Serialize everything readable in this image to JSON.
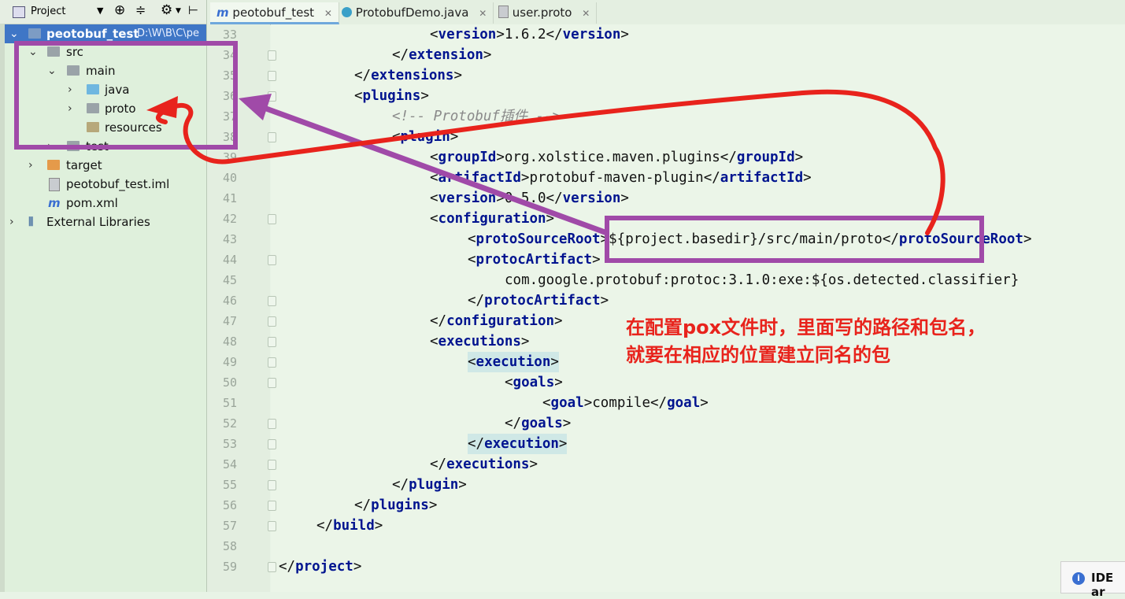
{
  "project_toolbar": {
    "title": "Project"
  },
  "tree": {
    "root_name": "peotobuf_test",
    "root_path": "D:\\W\\B\\C\\pe",
    "src": "src",
    "main": "main",
    "java": "java",
    "proto": "proto",
    "resources": "resources",
    "test": "test",
    "target": "target",
    "iml": "peotobuf_test.iml",
    "pom": "pom.xml",
    "ext": "External Libraries"
  },
  "tabs": [
    {
      "label": "peotobuf_test"
    },
    {
      "label": "ProtobufDemo.java"
    },
    {
      "label": "user.proto"
    }
  ],
  "gutter": {
    "line_numbers": [
      "33",
      "34",
      "35",
      "36",
      "37",
      "38",
      "39",
      "40",
      "41",
      "42",
      "43",
      "44",
      "45",
      "46",
      "47",
      "48",
      "49",
      "50",
      "51",
      "52",
      "53",
      "54",
      "55",
      "56",
      "57",
      "58",
      "59"
    ]
  },
  "code": {
    "l33_tag": "version",
    "l33_val": "1.6.2",
    "l34_tag": "extension",
    "l35_tag": "extensions",
    "l36_tag": "plugins",
    "l37_comment": "<!-- Protobuf插件 -->",
    "l38_tag": "plugin",
    "l39_tag": "groupId",
    "l39_val": "org.xolstice.maven.plugins",
    "l40_tag": "artifactId",
    "l40_val": "protobuf-maven-plugin",
    "l41_tag": "version",
    "l41_val": "0.5.0",
    "l42_tag": "configuration",
    "l43_tag": "protoSourceRoot",
    "l43_val": "${project.basedir}/src/main/proto",
    "l44_tag": "protocArtifact",
    "l45_val": "com.google.protobuf:protoc:3.1.0:exe:${os.detected.classifier}",
    "l46_tag": "protocArtifact",
    "l47_tag": "configuration",
    "l48_tag": "executions",
    "l49_tag": "execution",
    "l50_tag": "goals",
    "l51_tag": "goal",
    "l51_val": "compile",
    "l52_tag": "goals",
    "l53_tag": "execution",
    "l54_tag": "executions",
    "l55_tag": "plugin",
    "l56_tag": "plugins",
    "l57_tag": "build",
    "l59_tag": "project"
  },
  "annotation": {
    "line1": "在配置pox文件时，里面写的路径和包名，",
    "line2": "就要在相应的位置建立同名的包"
  },
  "popup": {
    "text": "IDE ar"
  },
  "colors": {
    "annotation_red": "#e8231c",
    "highlight_box_purple": "#a04aa8",
    "xml_tag_blue": "#00148f",
    "selection_blue": "#3f76c6"
  }
}
